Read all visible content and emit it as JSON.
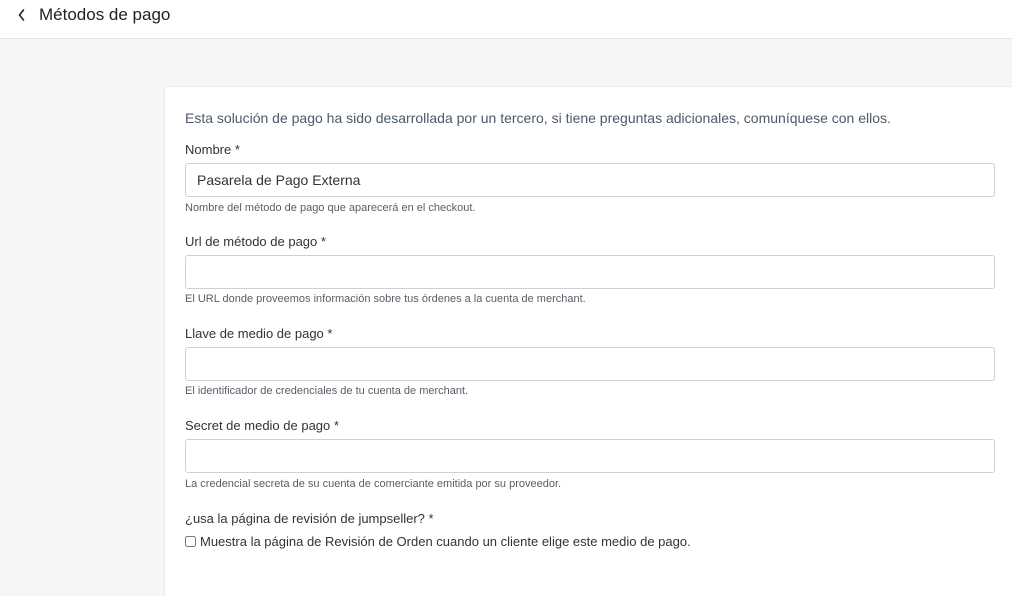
{
  "header": {
    "back_icon": "chevron-left-icon",
    "title": "Métodos de pago"
  },
  "form": {
    "notice": "Esta solución de pago ha sido desarrollada por un tercero, si tiene preguntas adicionales, comuníquese con ellos.",
    "name": {
      "label": "Nombre *",
      "value": "Pasarela de Pago Externa",
      "help": "Nombre del método de pago que aparecerá en el checkout."
    },
    "url": {
      "label": "Url de método de pago *",
      "value": "",
      "help": "El URL donde proveemos información sobre tus órdenes a la cuenta de merchant."
    },
    "key": {
      "label": "Llave de medio de pago *",
      "value": "",
      "help": "El identificador de credenciales de tu cuenta de merchant."
    },
    "secret": {
      "label": "Secret de medio de pago *",
      "value": "",
      "help": "La credencial secreta de su cuenta de comerciante emitida por su proveedor."
    },
    "review": {
      "label": "¿usa la página de revisión de jumpseller? *",
      "checkbox_label": "Muestra la página de Revisión de Orden cuando un cliente elige este medio de pago.",
      "checked": false
    }
  }
}
